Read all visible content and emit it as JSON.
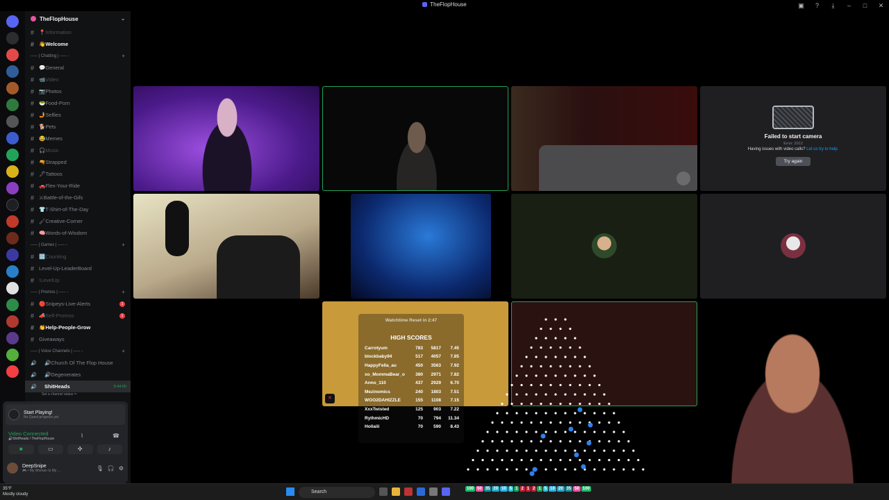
{
  "window": {
    "title": "TheFlopHouse"
  },
  "server": {
    "name": "TheFlopHouse"
  },
  "channels": [
    {
      "type": "text",
      "label": "📍Information",
      "style": "dim"
    },
    {
      "type": "text",
      "label": "👋Welcome",
      "style": "bold"
    },
    {
      "type": "cat",
      "label": "----- | Chatting | ----- -"
    },
    {
      "type": "text",
      "label": "💬General"
    },
    {
      "type": "text",
      "label": "📹Video",
      "style": "dim"
    },
    {
      "type": "text",
      "label": "📷Photos"
    },
    {
      "type": "text",
      "label": "🥗Food-Porn"
    },
    {
      "type": "text",
      "label": "🤳Selfies"
    },
    {
      "type": "text",
      "label": "🐕Pets"
    },
    {
      "type": "text",
      "label": "😂Memes"
    },
    {
      "type": "text",
      "label": "🎧Music",
      "style": "dim"
    },
    {
      "type": "text",
      "label": "🔫Strapped"
    },
    {
      "type": "text",
      "label": "🖋Tattoos"
    },
    {
      "type": "text",
      "label": "🚗Flex-Your-Ride"
    },
    {
      "type": "text",
      "label": "⚔Battle-of-the-Gifs"
    },
    {
      "type": "text",
      "label": "👕T-Shirt-of-The-Day"
    },
    {
      "type": "text",
      "label": "🖌Creative-Corner"
    },
    {
      "type": "text",
      "label": "🧠Words-of-Wisdom"
    },
    {
      "type": "cat",
      "label": "----- | Games | ----- -"
    },
    {
      "type": "text",
      "label": "🔢Counting",
      "style": "dim"
    },
    {
      "type": "text",
      "label": "Level-Up-LeaderBoard"
    },
    {
      "type": "text",
      "label": "!LevelUp",
      "style": "dim"
    },
    {
      "type": "cat",
      "label": "----- | Promos | ----- -"
    },
    {
      "type": "text",
      "label": "🔴Snipeys-Live-Alerts",
      "count": "1"
    },
    {
      "type": "text",
      "label": "📣Self-Promos",
      "style": "dim",
      "count": "1"
    },
    {
      "type": "text",
      "label": "👏Help-People-Grow",
      "style": "bold"
    },
    {
      "type": "text",
      "label": "Giveaways"
    },
    {
      "type": "cat",
      "label": "----- | Voice Channels | ----- -"
    },
    {
      "type": "voice",
      "label": "🔊Church Of The Flop House"
    },
    {
      "type": "voice",
      "label": "🔊Degenerates"
    },
    {
      "type": "voice",
      "label": "ShitHeads",
      "active": true,
      "time": "5:44:00",
      "sub": "Set a channel status ✏"
    }
  ],
  "panel": {
    "start_title": "Start Playing!",
    "start_sub": "No Quest progress yet",
    "vc_title": "Video Connected",
    "vc_sub": "🔊ShitHeads / TheFlopHouse",
    "user_name": "DeepSnipe",
    "user_status": "🎮 • My Woman Is My ..."
  },
  "failed_tile": {
    "heading": "Failed to start camera",
    "error": "Error: 2012",
    "question": "Having issues with video calls?",
    "link": "Let us try to help.",
    "button": "Try again"
  },
  "scoreboard": {
    "timer": "Watchtime Reset in 2:47",
    "title": "HIGH SCORES",
    "rows": [
      {
        "name": "Carrotyum",
        "a": "783",
        "b": "5817",
        "c": "7.45"
      },
      {
        "name": "blockbaby94",
        "a": "517",
        "b": "4057",
        "c": "7.85"
      },
      {
        "name": "HappyFella_au",
        "a": "450",
        "b": "3563",
        "c": "7.92"
      },
      {
        "name": "xo_MommaBear_o",
        "a": "380",
        "b": "2971",
        "c": "7.82"
      },
      {
        "name": "Anno_110",
        "a": "437",
        "b": "2929",
        "c": "6.70"
      },
      {
        "name": "Mezinomics",
        "a": "240",
        "b": "1803",
        "c": "7.51"
      },
      {
        "name": "WOO2DAHIZZLE",
        "a": "155",
        "b": "1108",
        "c": "7.15"
      },
      {
        "name": "XxxTwisted",
        "a": "125",
        "b": "903",
        "c": "7.22"
      },
      {
        "name": "RythmicHD",
        "a": "70",
        "b": "794",
        "c": "11.34"
      },
      {
        "name": "Hollaiii",
        "a": "70",
        "b": "590",
        "c": "8.43"
      }
    ]
  },
  "taskbar": {
    "temp": "35°F",
    "weather": "Mostly cloudy",
    "search": "Search",
    "multipliers": [
      "100",
      "50",
      "35",
      "20",
      "10",
      "5",
      "1",
      "2",
      "1",
      "2",
      "1",
      "5",
      "10",
      "20",
      "35",
      "50",
      "100"
    ]
  }
}
